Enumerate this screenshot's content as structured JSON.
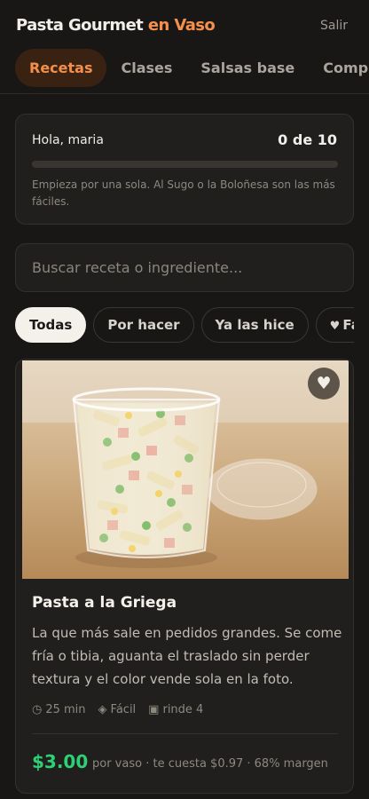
{
  "header": {
    "brand_main": "Pasta Gourmet",
    "brand_accent": "en Vaso",
    "logout_label": "Salir",
    "tabs": [
      {
        "label": "Recetas",
        "active": true
      },
      {
        "label": "Clases",
        "active": false
      },
      {
        "label": "Salsas base",
        "active": false
      },
      {
        "label": "Compra",
        "active": false
      }
    ]
  },
  "progress": {
    "greeting": "Hola, maria",
    "count": "0 de 10",
    "fraction": 0,
    "hint": "Empieza por una sola. Al Sugo o la Boloñesa son las más fáciles."
  },
  "search": {
    "placeholder": "Buscar receta o ingrediente...",
    "value": ""
  },
  "filters": [
    {
      "label": "Todas",
      "active": true
    },
    {
      "label": "Por hacer",
      "active": false
    },
    {
      "label": "Ya las hice",
      "active": false
    },
    {
      "label": "Favoritas",
      "active": false,
      "icon": "heart-icon"
    }
  ],
  "recipe": {
    "title": "Pasta a la Griega",
    "description": "La que más sale en pedidos grandes. Se come fría o tibia, aguanta el traslado sin perder textura y el color vende sola en la foto.",
    "time": "25 min",
    "difficulty": "Fácil",
    "yield": "rinde 4",
    "price": "$3.00",
    "price_note": "por vaso · te cuesta $0.97 · 68% margen",
    "image_icon": "pasta-cup-photo",
    "favorite_icon": "heart-icon"
  },
  "colors": {
    "background": "#181716",
    "accent": "#f2904b",
    "price_green": "#2fcf76",
    "card": "#201f1d"
  }
}
